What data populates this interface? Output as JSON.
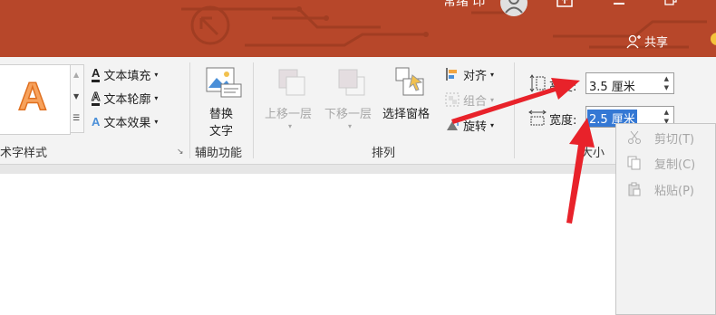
{
  "titlebar": {
    "user_name": "常绪 印",
    "share_label": "共享"
  },
  "wordart": {
    "group_label": "术字样式",
    "preview_letter": "A",
    "text_fill": "文本填充",
    "text_outline": "文本轮廓",
    "text_effects": "文本效果"
  },
  "accessibility": {
    "alt_text_line1": "替换",
    "alt_text_line2": "文字",
    "group_label": "辅助功能"
  },
  "arrange": {
    "bring_forward": "上移一层",
    "send_backward": "下移一层",
    "selection_pane": "选择窗格",
    "align": "对齐",
    "group": "组合",
    "rotate": "旋转",
    "group_label": "排列"
  },
  "size": {
    "height_label": "高度:",
    "height_value": "3.5 厘米",
    "width_label": "宽度:",
    "width_value": "2.5 厘米",
    "group_label": "大小"
  },
  "context_menu": {
    "cut": "剪切(T)",
    "copy": "复制(C)",
    "paste": "粘贴(P)"
  },
  "colors": {
    "title_bar": "#b7472a",
    "annotation_arrow": "#e8222a",
    "selection": "#3478d4"
  }
}
